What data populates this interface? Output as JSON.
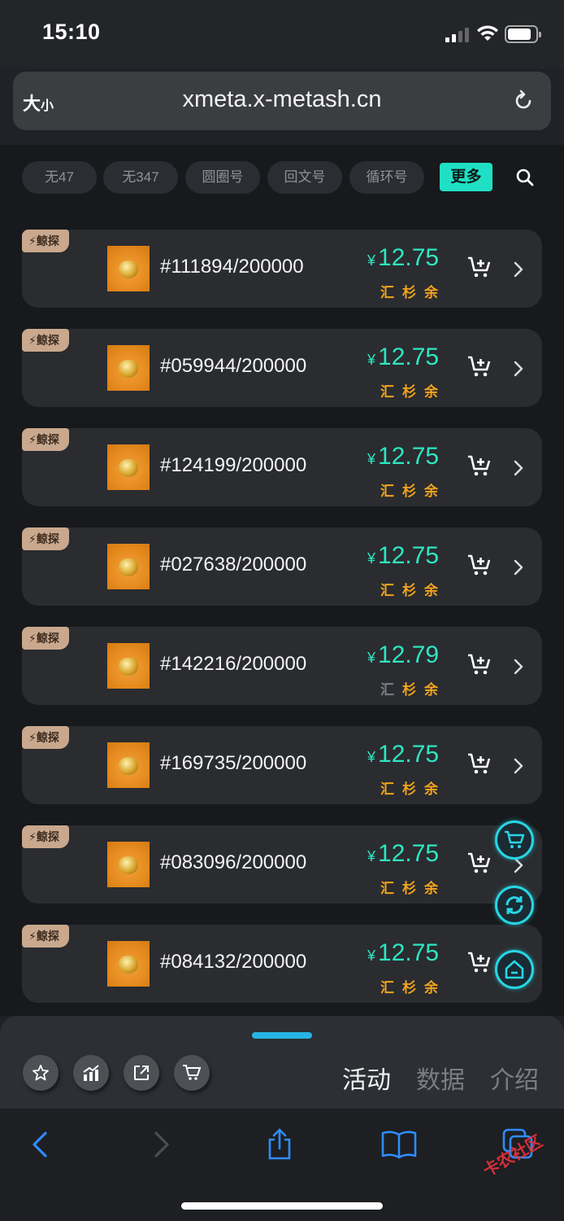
{
  "status_bar": {
    "time": "15:10"
  },
  "browser": {
    "text_size_big": "大",
    "text_size_small": "小",
    "url": "xmeta.x-metash.cn"
  },
  "filters": [
    {
      "label": "无47"
    },
    {
      "label": "无347"
    },
    {
      "label": "圆圈号"
    },
    {
      "label": "回文号"
    },
    {
      "label": "循环号"
    }
  ],
  "more_label": "更多",
  "listings": [
    {
      "badge": "鲸探",
      "serial": "#111894/200000",
      "currency": "¥",
      "price": "12.75",
      "tags": [
        "汇",
        "杉",
        "余"
      ],
      "first_tag_grey": false
    },
    {
      "badge": "鲸探",
      "serial": "#059944/200000",
      "currency": "¥",
      "price": "12.75",
      "tags": [
        "汇",
        "杉",
        "余"
      ],
      "first_tag_grey": false
    },
    {
      "badge": "鲸探",
      "serial": "#124199/200000",
      "currency": "¥",
      "price": "12.75",
      "tags": [
        "汇",
        "杉",
        "余"
      ],
      "first_tag_grey": false
    },
    {
      "badge": "鲸探",
      "serial": "#027638/200000",
      "currency": "¥",
      "price": "12.75",
      "tags": [
        "汇",
        "杉",
        "余"
      ],
      "first_tag_grey": false
    },
    {
      "badge": "鲸探",
      "serial": "#142216/200000",
      "currency": "¥",
      "price": "12.79",
      "tags": [
        "汇",
        "杉",
        "余"
      ],
      "first_tag_grey": true
    },
    {
      "badge": "鲸探",
      "serial": "#169735/200000",
      "currency": "¥",
      "price": "12.75",
      "tags": [
        "汇",
        "杉",
        "余"
      ],
      "first_tag_grey": false
    },
    {
      "badge": "鲸探",
      "serial": "#083096/200000",
      "currency": "¥",
      "price": "12.75",
      "tags": [
        "汇",
        "杉",
        "余"
      ],
      "first_tag_grey": false
    },
    {
      "badge": "鲸探",
      "serial": "#084132/200000",
      "currency": "¥",
      "price": "12.75",
      "tags": [
        "汇",
        "杉",
        "余"
      ],
      "first_tag_grey": false
    }
  ],
  "floating_buttons": [
    "cart-icon",
    "refresh-icon",
    "home-icon"
  ],
  "sheet": {
    "icons": [
      "star-icon",
      "chart-icon",
      "share-icon",
      "cart-icon"
    ],
    "tabs": [
      {
        "label": "活动",
        "active": true
      },
      {
        "label": "数据",
        "active": false
      },
      {
        "label": "介绍",
        "active": false
      }
    ]
  },
  "toolbar": {
    "icons": [
      "back-icon",
      "forward-icon",
      "share-icon",
      "bookmarks-icon",
      "tabs-icon"
    ]
  },
  "watermark": "卡农社区",
  "colors": {
    "accent": "#1fe0c4",
    "price": "#2ee6c1",
    "tag": "#f3a41c",
    "safari_blue": "#2f8cff"
  }
}
